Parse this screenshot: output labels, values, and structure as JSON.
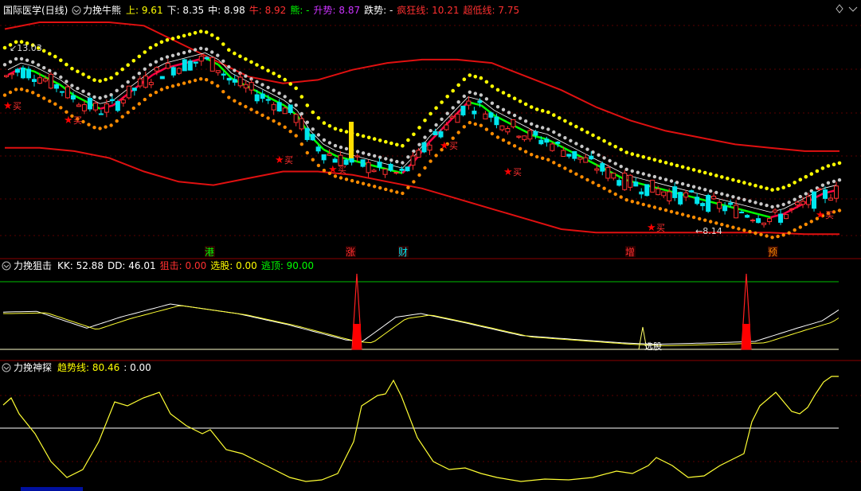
{
  "colors": {
    "background": "#000000",
    "panel_border": "#8b0000",
    "grid_dash": "#6b0000",
    "up_candle": "#ff3030",
    "down_candle": "#00e5ee",
    "channel_line": "#e01010",
    "dots_upper": "#ffff00",
    "dots_middle": "#c8c8c8",
    "dots_lower": "#ff8c00",
    "trend_green": "#00ff00",
    "trend_red": "#ff0044",
    "trend_white": "#ffffff",
    "trend_magenta": "#cc33cc",
    "k_line": "#ffffff",
    "d_line": "#ffff33",
    "upper_ref": "#00c000",
    "lower_ref": "#ffffcc"
  },
  "main_panel": {
    "stock_name": "国际医学(日线)",
    "indicator_name": "力挽牛熊",
    "legend": [
      {
        "label": "上:",
        "value": "9.61",
        "color": "#ffff00"
      },
      {
        "label": "下:",
        "value": "8.35",
        "color": "#ffffff"
      },
      {
        "label": "中:",
        "value": "8.98",
        "color": "#ffffff"
      },
      {
        "label": "牛:",
        "value": "8.92",
        "color": "#ff3030"
      },
      {
        "label": "熊:",
        "value": "-",
        "color": "#00ff00"
      },
      {
        "label": "升势:",
        "value": "8.87",
        "color": "#cc33ff"
      },
      {
        "label": "跌势:",
        "value": "-",
        "color": "#ffffff"
      },
      {
        "label": "疯狂线:",
        "value": "10.21",
        "color": "#ff3030"
      },
      {
        "label": "超低线:",
        "value": "7.75",
        "color": "#ff3030"
      }
    ],
    "high_label": "13.03",
    "low_label": "8.14",
    "buy_label": "买",
    "event_labels": [
      {
        "text": "港",
        "color": "#00ff00",
        "x": 263
      },
      {
        "text": "涨",
        "color": "#ff3030",
        "x": 440
      },
      {
        "text": "财",
        "color": "#00e5ee",
        "x": 506
      },
      {
        "text": "增",
        "color": "#ff3030",
        "x": 791
      },
      {
        "text": "预",
        "color": "#ff8c00",
        "x": 970
      }
    ]
  },
  "panel2": {
    "title": "力挽狙击",
    "legend": [
      {
        "label": "KK:",
        "value": "52.88",
        "color": "#ffffff"
      },
      {
        "label": "DD:",
        "value": "46.01",
        "color": "#ffffff"
      },
      {
        "label": "狙击:",
        "value": "0.00",
        "color": "#ff3030"
      },
      {
        "label": "选股:",
        "value": "0.00",
        "color": "#ffff00"
      },
      {
        "label": "逃顶:",
        "value": "90.00",
        "color": "#00ff00"
      }
    ],
    "annotation": "选股"
  },
  "panel3": {
    "title": "力挽神探",
    "legend": [
      {
        "label": "趋势线:",
        "value": "80.46",
        "color": "#ffff00"
      },
      {
        "label": ":",
        "value": "0.00",
        "color": "#ffffff"
      }
    ]
  },
  "chart_data": [
    {
      "type": "candlestick",
      "name": "力挽牛熊",
      "y_range": [
        7.5,
        14.0
      ],
      "candles_close": [
        12.4,
        12.6,
        12.5,
        12.3,
        12.1,
        11.8,
        11.6,
        11.4,
        11.5,
        11.8,
        12.1,
        12.4,
        12.6,
        12.7,
        12.8,
        12.9,
        12.7,
        12.3,
        12.1,
        11.9,
        11.7,
        11.5,
        11.2,
        10.6,
        10.2,
        10.0,
        9.9,
        9.8,
        9.7,
        9.6,
        9.5,
        9.9,
        10.4,
        10.8,
        11.2,
        11.6,
        11.5,
        11.2,
        11.0,
        10.8,
        10.6,
        10.5,
        10.3,
        10.1,
        9.9,
        9.7,
        9.5,
        9.3,
        9.2,
        9.1,
        9.0,
        8.9,
        8.8,
        8.7,
        8.6,
        8.5,
        8.4,
        8.3,
        8.2,
        8.3,
        8.5,
        8.7,
        8.9,
        9.0
      ],
      "channel_upper": [
        13.8,
        14.0,
        14.0,
        14.0,
        13.9,
        13.4,
        12.9,
        12.4,
        12.2,
        12.3,
        12.6,
        12.8,
        12.9,
        12.9,
        12.8,
        12.4,
        12.0,
        11.5,
        11.1,
        10.8,
        10.6,
        10.4,
        10.3,
        10.2,
        10.2
      ],
      "channel_lower": [
        10.3,
        10.3,
        10.2,
        10.0,
        9.6,
        9.3,
        9.2,
        9.4,
        9.6,
        9.6,
        9.5,
        9.3,
        9.1,
        8.8,
        8.5,
        8.2,
        7.9,
        7.8,
        7.8,
        7.8,
        7.8,
        7.8,
        7.8,
        7.75,
        7.75
      ],
      "last_values": {
        "upper": 9.61,
        "lower": 8.35,
        "mid": 8.98,
        "bull": 8.92,
        "rise": 8.87,
        "crazy_line": 10.21,
        "super_low_line": 7.75
      },
      "high": 13.03,
      "low": 8.14
    },
    {
      "type": "line",
      "name": "力挽狙击",
      "series": [
        {
          "name": "KK",
          "last": 52.88
        },
        {
          "name": "DD",
          "last": 46.01
        }
      ],
      "reference_lines": [
        90,
        0
      ],
      "signals": {
        "狙击": 0.0,
        "选股": 0.0,
        "逃顶": 90.0
      }
    },
    {
      "type": "line",
      "name": "力挽神探",
      "series": [
        {
          "name": "趋势线",
          "last": 80.46
        }
      ],
      "reference_value": 0.0
    }
  ]
}
